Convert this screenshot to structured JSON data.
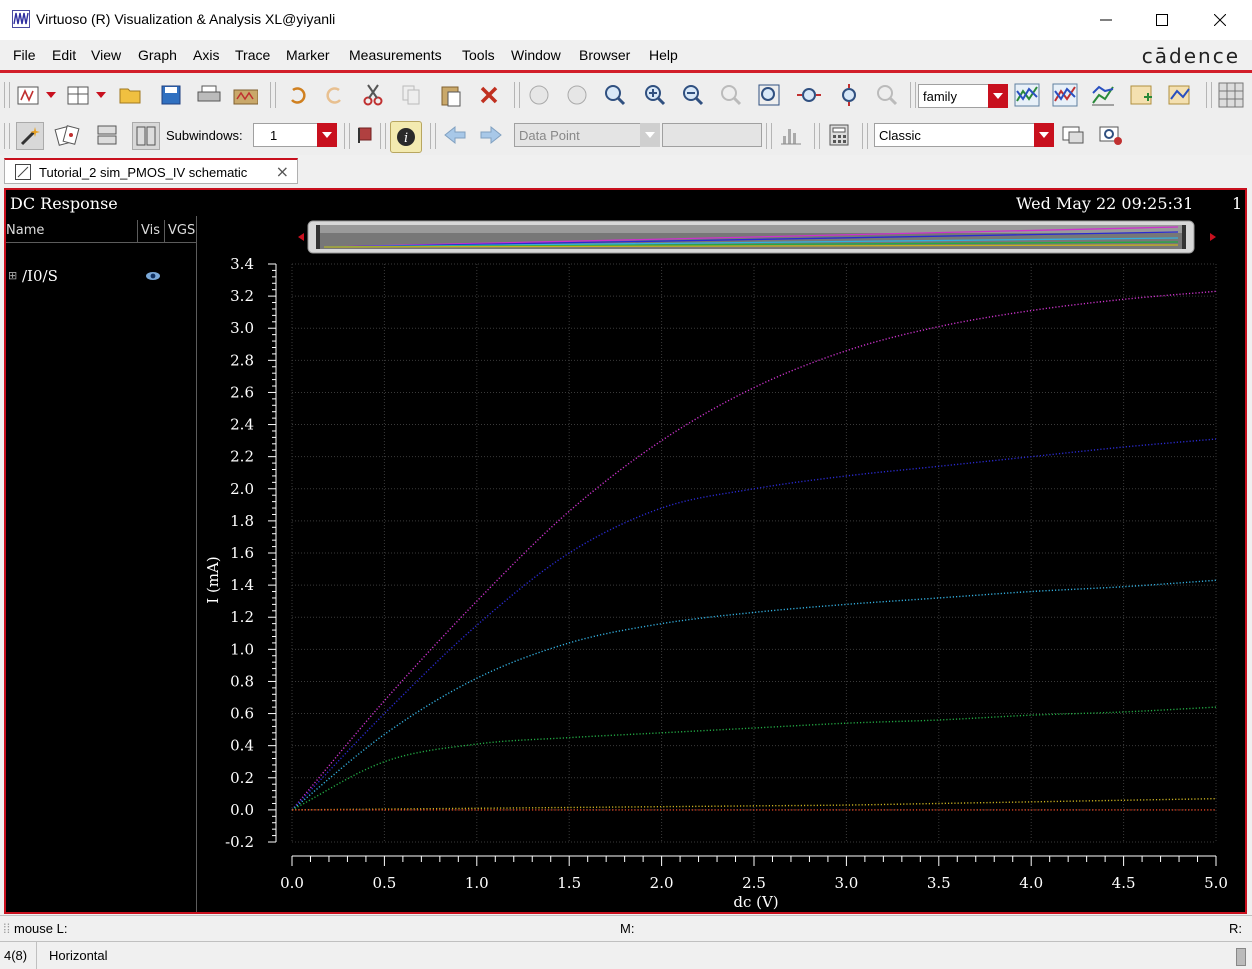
{
  "window": {
    "title": "Virtuoso (R) Visualization & Analysis XL@yiyanli"
  },
  "menu": {
    "items": [
      "File",
      "Edit",
      "View",
      "Graph",
      "Axis",
      "Trace",
      "Marker",
      "Measurements",
      "Tools",
      "Window",
      "Browser",
      "Help"
    ],
    "brand": "cādence"
  },
  "toolbar": {
    "family_combo": "family",
    "subwindows_label": "Subwindows:",
    "subwindows_value": "1",
    "datapoint_combo": "Data Point",
    "style_combo": "Classic"
  },
  "tab": {
    "label": "Tutorial_2 sim_PMOS_IV schematic"
  },
  "plot": {
    "title": "DC Response",
    "timestamp": "Wed May 22 09:25:31",
    "subwindow_number": "1",
    "legend": {
      "col_name": "Name",
      "col_vis": "Vis",
      "col_param": "VGS",
      "signal": "/I0/S"
    }
  },
  "chart_data": {
    "type": "line",
    "xlabel": "dc (V)",
    "ylabel": "I (mA)",
    "xlim": [
      0.0,
      5.0
    ],
    "ylim": [
      -0.2,
      3.4
    ],
    "x_ticks": [
      0.0,
      0.5,
      1.0,
      1.5,
      2.0,
      2.5,
      3.0,
      3.5,
      4.0,
      4.5,
      5.0
    ],
    "y_ticks": [
      -0.2,
      0.0,
      0.2,
      0.4,
      0.6,
      0.8,
      1.0,
      1.2,
      1.4,
      1.6,
      1.8,
      2.0,
      2.2,
      2.4,
      2.6,
      2.8,
      3.0,
      3.2,
      3.4
    ],
    "grid": true,
    "x": [
      0.0,
      0.5,
      1.0,
      1.5,
      2.0,
      2.5,
      3.0,
      3.5,
      4.0,
      4.5,
      5.0
    ],
    "series": [
      {
        "color": "#cc33cc",
        "values": [
          0.0,
          0.68,
          1.3,
          1.86,
          2.3,
          2.63,
          2.86,
          3.01,
          3.11,
          3.18,
          3.23
        ]
      },
      {
        "color": "#2a2ad0",
        "values": [
          0.0,
          0.6,
          1.15,
          1.6,
          1.88,
          2.0,
          2.08,
          2.14,
          2.2,
          2.26,
          2.31
        ]
      },
      {
        "color": "#33b0e0",
        "values": [
          0.0,
          0.47,
          0.82,
          1.04,
          1.16,
          1.23,
          1.28,
          1.32,
          1.36,
          1.39,
          1.43
        ]
      },
      {
        "color": "#22aa44",
        "values": [
          0.0,
          0.3,
          0.41,
          0.45,
          0.48,
          0.51,
          0.54,
          0.56,
          0.59,
          0.61,
          0.64
        ]
      },
      {
        "color": "#c8b020",
        "values": [
          0.0,
          0.005,
          0.01,
          0.015,
          0.02,
          0.025,
          0.03,
          0.04,
          0.05,
          0.06,
          0.07
        ]
      },
      {
        "color": "#e04020",
        "values": [
          0.0,
          0.0,
          0.0,
          0.0,
          0.0,
          0.0,
          0.0,
          0.0,
          0.0,
          0.0,
          0.0
        ]
      }
    ]
  },
  "status": {
    "mouse_left": "mouse L:",
    "mouse_mid": "M:",
    "mouse_right": "R:",
    "count": "4(8)",
    "mode": "Horizontal"
  }
}
